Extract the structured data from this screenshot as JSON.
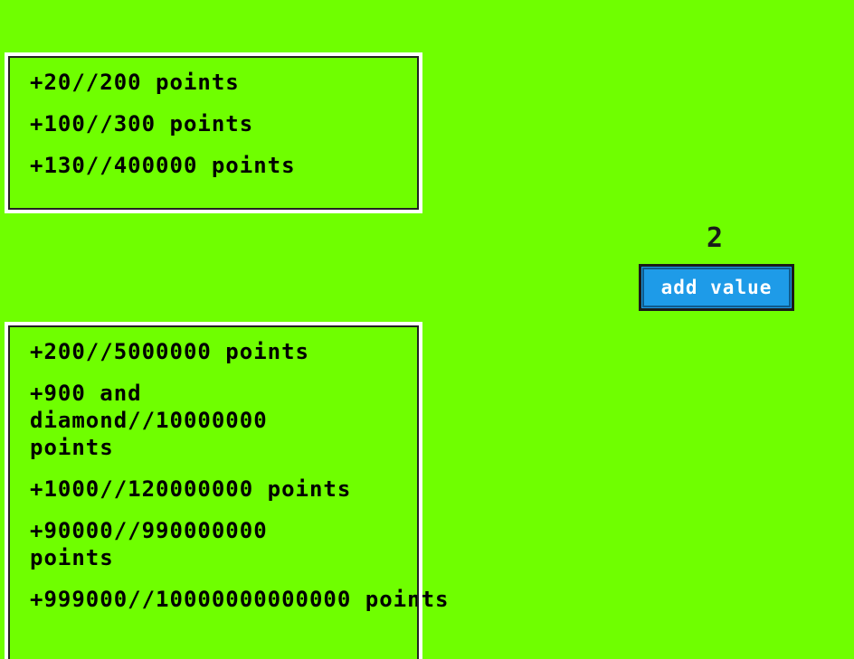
{
  "top_panel": {
    "items": [
      "+20//200 points",
      "+100//300 points",
      "+130//400000 points"
    ]
  },
  "bottom_panel": {
    "items": [
      "+200//5000000 points",
      "+900 and diamond//10000000 points",
      "+1000//120000000 points",
      "+90000//990000000 points",
      "+999000//10000000000000 points"
    ]
  },
  "counter": {
    "value": "2"
  },
  "add_button": {
    "label": "add value"
  },
  "colors": {
    "background": "#6fff00",
    "button": "#1e9be8"
  }
}
